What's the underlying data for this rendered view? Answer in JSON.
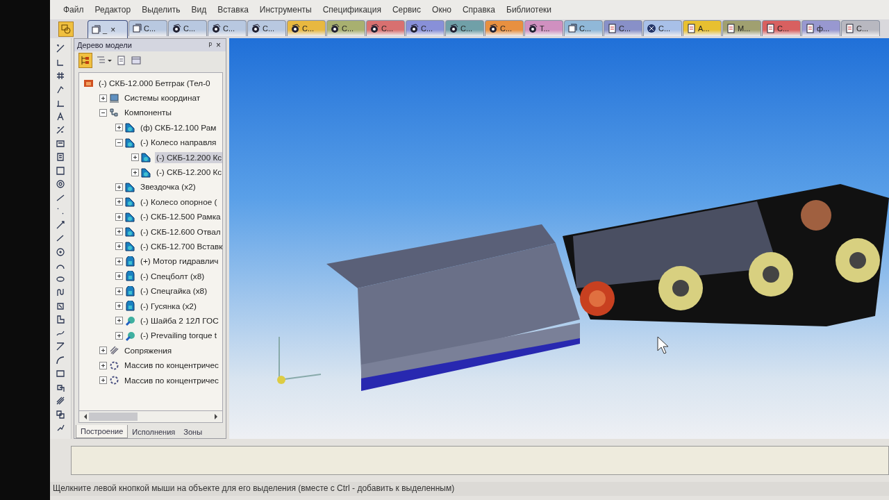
{
  "menu": [
    "Файл",
    "Редактор",
    "Выделить",
    "Вид",
    "Вставка",
    "Инструменты",
    "Спецификация",
    "Сервис",
    "Окно",
    "Справка",
    "Библиотеки"
  ],
  "tabs": [
    {
      "label": "_",
      "close": "×",
      "kind": "assembly",
      "color": "#c8d4e8",
      "selected": true
    },
    {
      "label": "С...",
      "kind": "assembly",
      "color": "#b8c8e0",
      "selected": false
    },
    {
      "label": "С...",
      "kind": "part",
      "color": "#b8c8e0",
      "selected": false
    },
    {
      "label": "С...",
      "kind": "part",
      "color": "#b8c8e0",
      "selected": false
    },
    {
      "label": "С...",
      "kind": "part",
      "color": "#b8c8e0",
      "selected": false
    },
    {
      "label": "С...",
      "kind": "part",
      "color": "#e8b840",
      "selected": false
    },
    {
      "label": "С...",
      "kind": "part",
      "color": "#a8b070",
      "selected": false
    },
    {
      "label": "С...",
      "kind": "part",
      "color": "#d87070",
      "selected": false
    },
    {
      "label": "С...",
      "kind": "part",
      "color": "#8890d8",
      "selected": false
    },
    {
      "label": "С...",
      "kind": "part",
      "color": "#70a0a8",
      "selected": false
    },
    {
      "label": "С...",
      "kind": "part",
      "color": "#e89040",
      "selected": false
    },
    {
      "label": "Т...",
      "kind": "part",
      "color": "#d090c0",
      "selected": false
    },
    {
      "label": "С...",
      "kind": "assembly",
      "color": "#90b8d8",
      "selected": false
    },
    {
      "label": "С...",
      "kind": "drawing",
      "color": "#8890c8",
      "selected": false
    },
    {
      "label": "С...",
      "kind": "library",
      "color": "#a8c0e8",
      "selected": false
    },
    {
      "label": "А...",
      "kind": "drawing",
      "color": "#e8c030",
      "selected": false
    },
    {
      "label": "М...",
      "kind": "drawing",
      "color": "#a0a070",
      "selected": false
    },
    {
      "label": "С...",
      "kind": "drawing",
      "color": "#d86060",
      "selected": false
    },
    {
      "label": "ф...",
      "kind": "drawing",
      "color": "#9898d0",
      "selected": false
    },
    {
      "label": "С...",
      "kind": "drawing",
      "color": "#b8b8c0",
      "selected": false
    }
  ],
  "tree_panel": {
    "title": "Дерево модели",
    "pin": "ᵖ",
    "close": "×",
    "items": [
      {
        "label": "(-) СКБ-12.000 Бетграк (Тел-0",
        "kind": "assembly",
        "selected": false,
        "children": [
          {
            "label": "Системы координат",
            "kind": "coords",
            "expanded": false,
            "selected": false
          },
          {
            "label": "Компоненты",
            "kind": "components",
            "expanded": true,
            "selected": false,
            "children": [
              {
                "label": "(ф) СКБ-12.100  Рам",
                "kind": "subassembly",
                "expanded": false,
                "selected": false
              },
              {
                "label": "(-) Колесо направля",
                "kind": "subassembly",
                "expanded": true,
                "selected": false,
                "children": [
                  {
                    "label": "(-) СКБ-12.200 Кс",
                    "kind": "subassembly",
                    "expanded": false,
                    "selected": true
                  },
                  {
                    "label": "(-) СКБ-12.200 Кс",
                    "kind": "subassembly",
                    "expanded": false,
                    "selected": false
                  }
                ]
              },
              {
                "label": "Звездочка (x2)",
                "kind": "subassembly",
                "expanded": false,
                "selected": false
              },
              {
                "label": "(-) Колесо опорное (",
                "kind": "subassembly",
                "expanded": false,
                "selected": false
              },
              {
                "label": "(-) СКБ-12.500 Рамка",
                "kind": "subassembly",
                "expanded": false,
                "selected": false
              },
              {
                "label": "(-) СКБ-12.600 Отвал",
                "kind": "subassembly",
                "expanded": false,
                "selected": false
              },
              {
                "label": "(-) СКБ-12.700 Вставк",
                "kind": "subassembly",
                "expanded": false,
                "selected": false
              },
              {
                "label": "(+) Мотор гидравлич",
                "kind": "part",
                "expanded": false,
                "selected": false
              },
              {
                "label": "(-) Спецболт (x8)",
                "kind": "part",
                "expanded": false,
                "selected": false
              },
              {
                "label": "(-) Спецгайка (x8)",
                "kind": "part",
                "expanded": false,
                "selected": false
              },
              {
                "label": "(-) Гусянка (x2)",
                "kind": "part",
                "expanded": false,
                "selected": false
              },
              {
                "label": "(-) Шайба 2 12Л ГОС",
                "kind": "standard",
                "expanded": false,
                "selected": false
              },
              {
                "label": "(-) Prevailing torque t",
                "kind": "standard",
                "expanded": false,
                "selected": false
              }
            ]
          },
          {
            "label": "Сопряжения",
            "kind": "mates",
            "expanded": false,
            "selected": false
          },
          {
            "label": "Массив по концентричес",
            "kind": "pattern",
            "expanded": false,
            "selected": false
          },
          {
            "label": "Массив по концентричес",
            "kind": "pattern",
            "expanded": false,
            "selected": false
          }
        ]
      }
    ],
    "tabs": [
      {
        "label": "Построение",
        "selected": true
      },
      {
        "label": "Исполнения",
        "selected": false
      },
      {
        "label": "Зоны",
        "selected": false
      }
    ]
  },
  "status_bar": "Щелкните левой кнопкой мыши на объекте для его выделения (вместе с Ctrl - добавить к выделенным)"
}
